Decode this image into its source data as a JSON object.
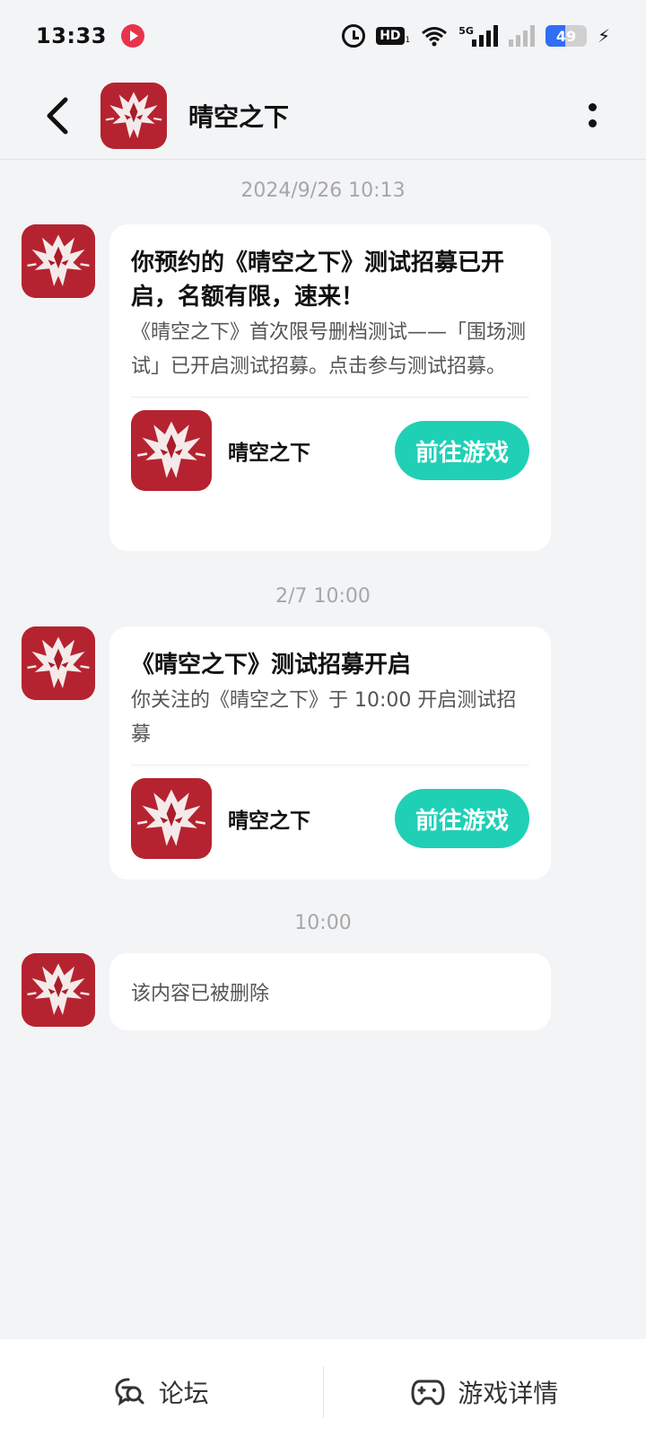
{
  "status_bar": {
    "time": "13:33",
    "hd_label": "HD",
    "hd_sub": "1",
    "network_label": "5G",
    "battery_percent": 49,
    "battery_label": "49"
  },
  "header": {
    "title": "晴空之下",
    "back_icon": "chevron-left-icon",
    "more_icon": "more-vertical-icon"
  },
  "colors": {
    "accent": "#1fd0b5",
    "background": "#f3f4f6",
    "logo_red": "#b3202c"
  },
  "messages": [
    {
      "timestamp": "2024/9/26  10:13",
      "title": "你预约的《晴空之下》测试招募已开启，名额有限，速来！",
      "body": "《晴空之下》首次限号删档测试——「围场测试」已开启测试招募。点击参与测试招募。",
      "game_name": "晴空之下",
      "button_label": "前往游戏"
    },
    {
      "timestamp": "2/7  10:00",
      "title": "《晴空之下》测试招募开启",
      "body": "你关注的《晴空之下》于 10:00 开启测试招募",
      "game_name": "晴空之下",
      "button_label": "前往游戏"
    },
    {
      "timestamp": "10:00",
      "body": "该内容已被删除"
    }
  ],
  "bottom_bar": {
    "forum_label": "论坛",
    "forum_icon": "forum-search-icon",
    "details_label": "游戏详情",
    "details_icon": "gamepad-icon"
  }
}
